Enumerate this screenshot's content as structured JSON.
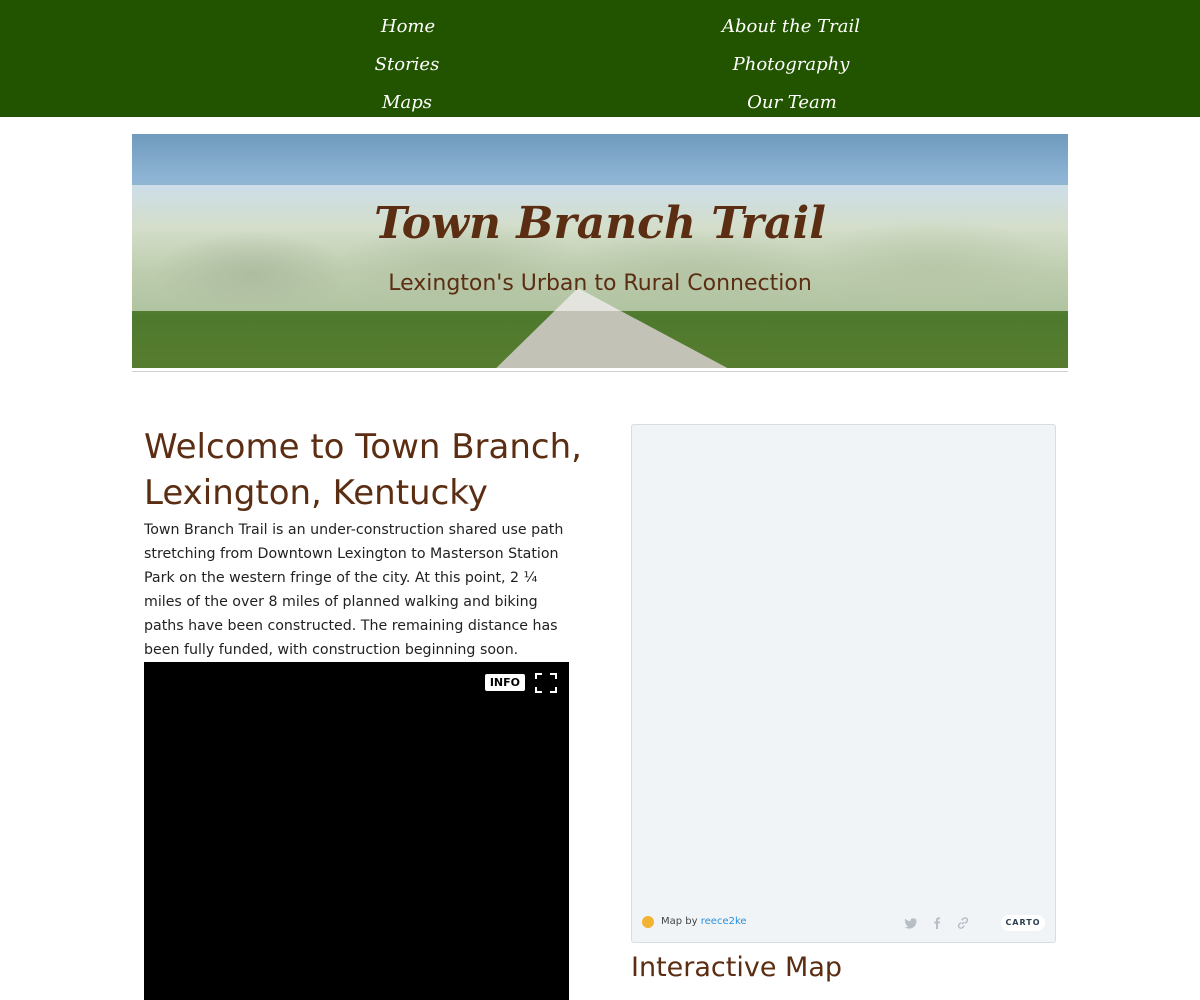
{
  "nav": {
    "items": [
      {
        "label": "Home"
      },
      {
        "label": "About the Trail"
      },
      {
        "label": "Stories"
      },
      {
        "label": "Photography"
      },
      {
        "label": "Maps"
      },
      {
        "label": "Our Team"
      }
    ],
    "background_color": "#225400"
  },
  "hero": {
    "title": "Town Branch Trail",
    "subtitle": "Lexington's Urban to Rural Connection"
  },
  "welcome": {
    "heading": "Welcome to Town Branch, Lexington, Kentucky",
    "body": "Town Branch Trail is an under-construction shared use path stretching from Downtown Lexington to Masterson Station Park on the western fringe of the city. At this point, 2 ¼ miles of the over 8 miles of planned walking and biking paths have been constructed. The remaining distance has been fully funded, with construction beginning soon."
  },
  "video": {
    "info_label": "INFO",
    "fullscreen_icon": "fullscreen-icon"
  },
  "map": {
    "map_by_label": "Map by",
    "author": "reece2ke",
    "carto_label": "CARTO",
    "share_icons": [
      "twitter-icon",
      "facebook-icon",
      "link-icon"
    ],
    "heading": "Interactive Map"
  },
  "colors": {
    "heading_brown": "#5b2d12",
    "nav_green": "#225400",
    "link_blue": "#2a8fd8"
  }
}
